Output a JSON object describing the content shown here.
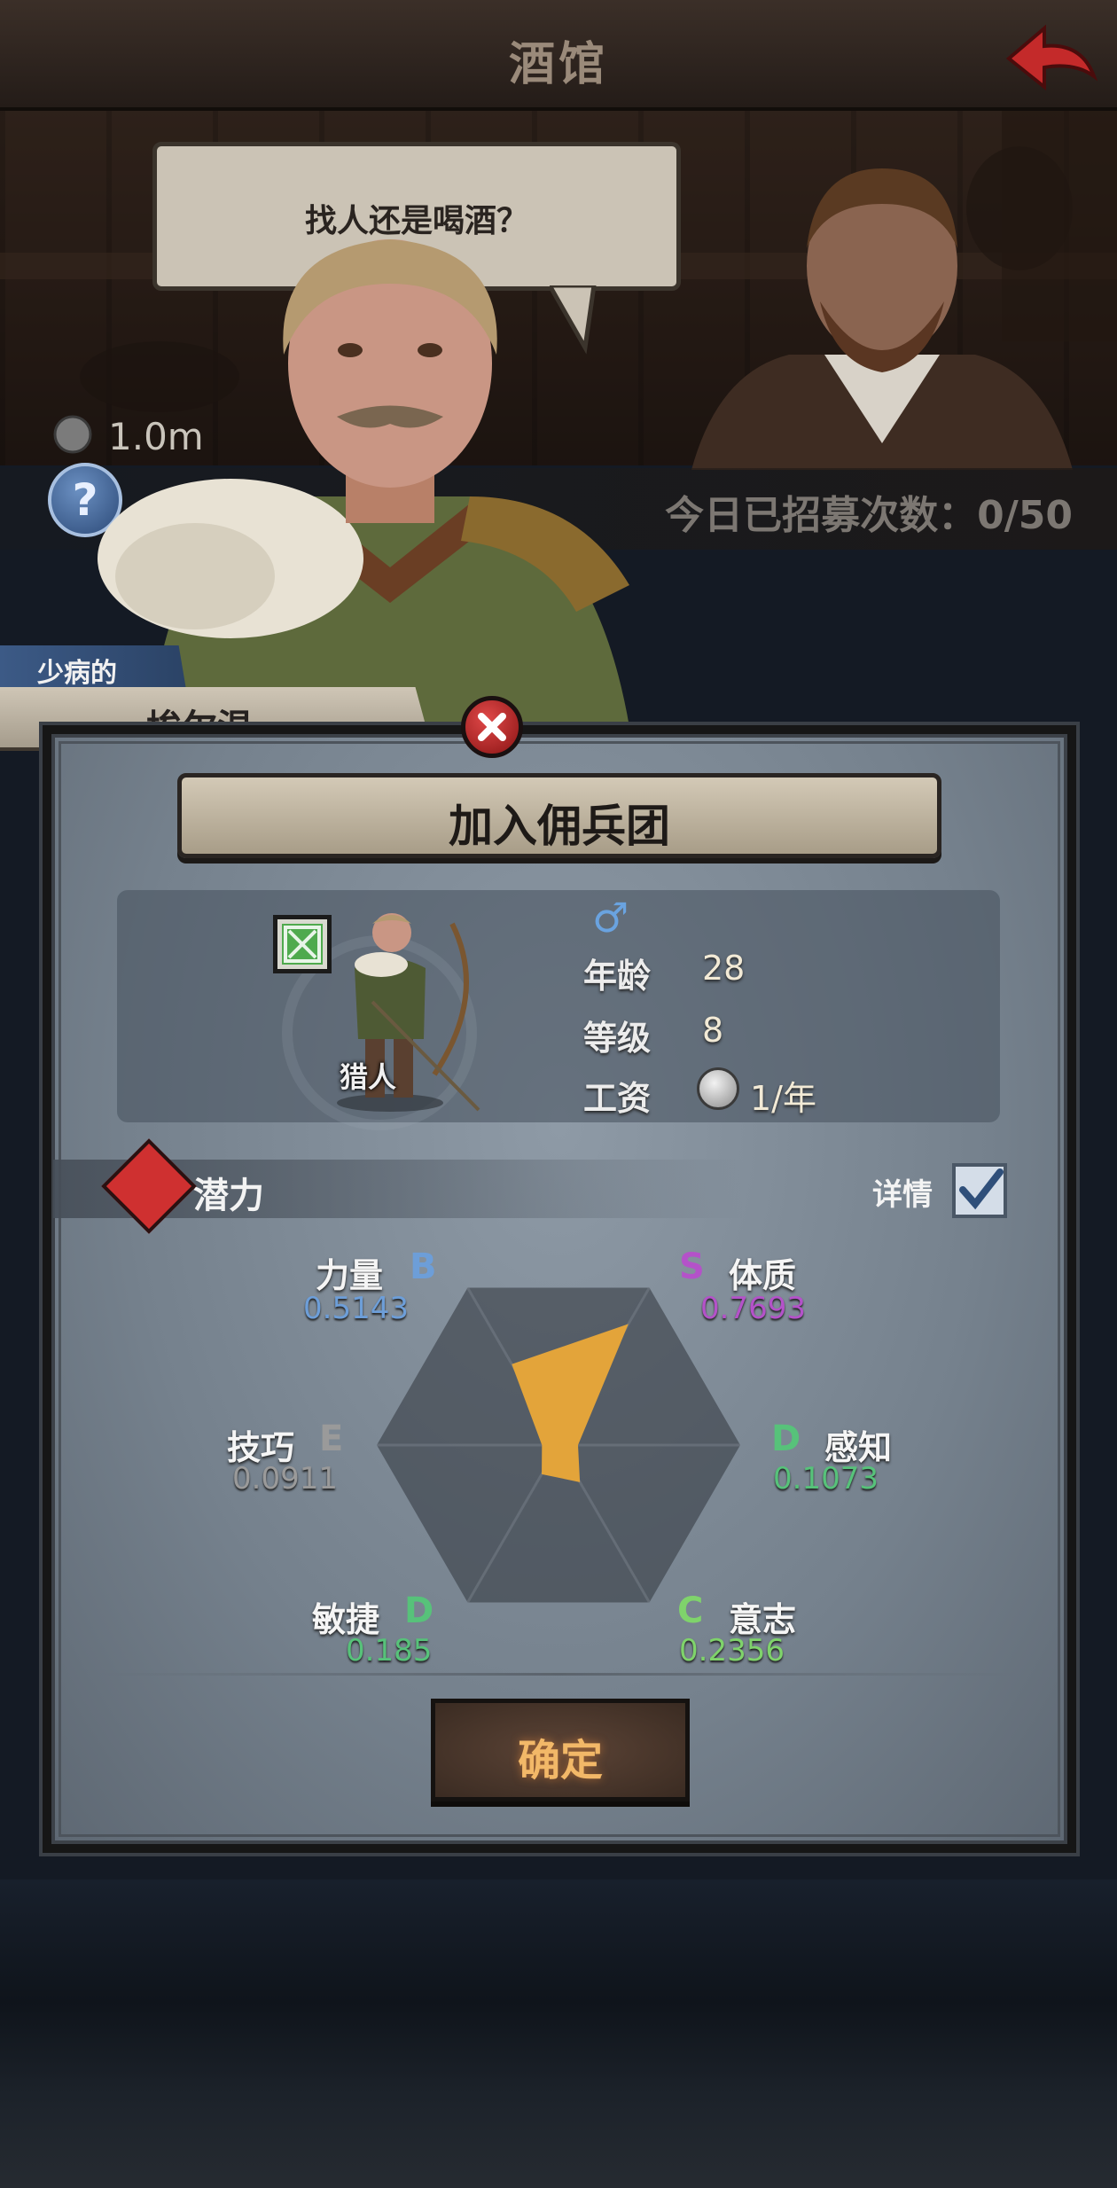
{
  "header": {
    "title": "酒馆",
    "back_icon": "back-arrow-icon",
    "accent": "#c42a2a"
  },
  "scene": {
    "speech": "找人还是喝酒？",
    "coins": "1.0m",
    "help_symbol": "?",
    "recruit_count_text": "今日已招募次数：0/50"
  },
  "character": {
    "trait": "少病的",
    "name": "埃尔温",
    "class": "猎人",
    "gender_symbol": "♂",
    "age_label": "年龄",
    "age": "28",
    "level_label": "等级",
    "level": "8",
    "salary_label": "工资",
    "salary": "1/年"
  },
  "panel": {
    "title": "加入佣兵团",
    "potential_label": "潜力",
    "details_label": "详情",
    "details_checked": true,
    "confirm_label": "确定"
  },
  "attributes": [
    {
      "name": "力量",
      "grade": "B",
      "value": "0.5143",
      "color": "#6d9ed8"
    },
    {
      "name": "体质",
      "grade": "S",
      "value": "0.7693",
      "color": "#b452c9"
    },
    {
      "name": "感知",
      "grade": "D",
      "value": "0.1073",
      "color": "#57c27a"
    },
    {
      "name": "意志",
      "grade": "C",
      "value": "0.2356",
      "color": "#7fd36b"
    },
    {
      "name": "敏捷",
      "grade": "D",
      "value": "0.185",
      "color": "#57c27a"
    },
    {
      "name": "技巧",
      "grade": "E",
      "value": "0.0911",
      "color": "#9a9a9a"
    }
  ],
  "radar_fill": "#e3a43a"
}
